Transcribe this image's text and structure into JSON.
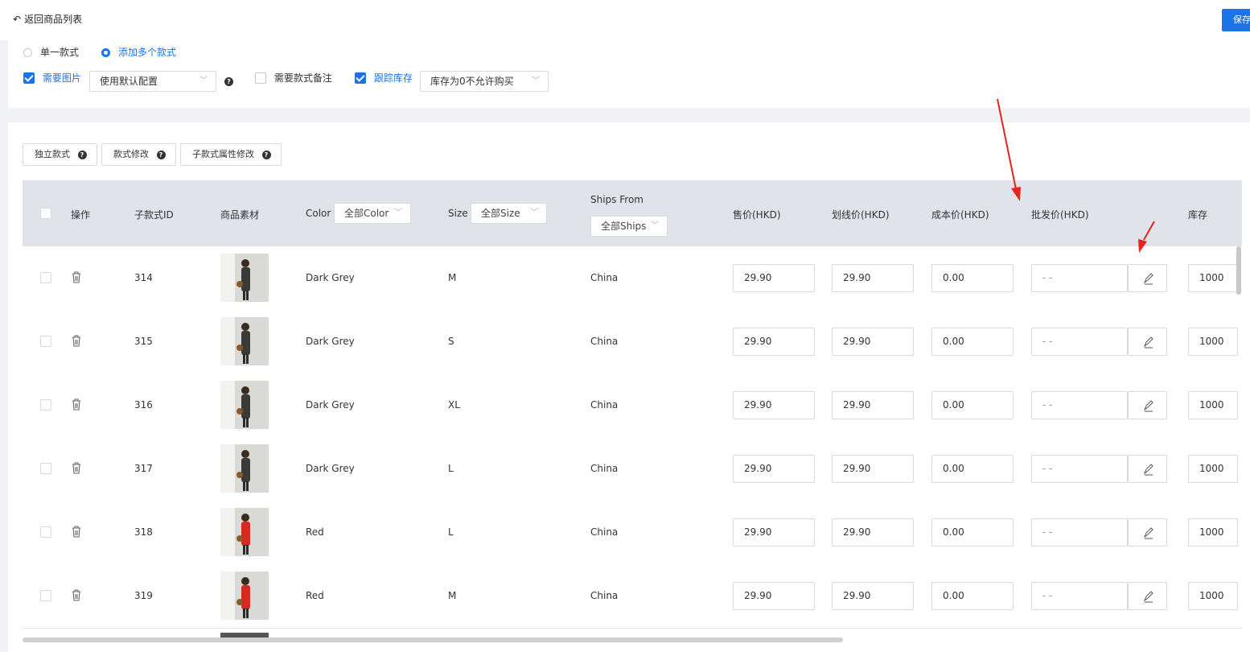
{
  "header": {
    "back_label": "返回商品列表",
    "save_label": "保存"
  },
  "variant_mode": {
    "single_label": "单一款式",
    "multi_label": "添加多个款式",
    "selected": "multi"
  },
  "options": {
    "need_image_label": "需要图片",
    "need_image_checked": true,
    "image_config_value": "使用默认配置",
    "need_remark_label": "需要款式备注",
    "need_remark_checked": false,
    "track_stock_label": "跟踪库存",
    "track_stock_checked": true,
    "stock_policy_value": "库存为0不允许购买"
  },
  "toolbar": {
    "independent_label": "独立款式",
    "variant_edit_label": "款式修改",
    "sub_attr_edit_label": "子款式属性修改"
  },
  "table": {
    "headers": {
      "action": "操作",
      "sub_id": "子款式ID",
      "material": "商品素材",
      "color": "Color",
      "color_filter": "全部Color",
      "size": "Size",
      "size_filter": "全部Size",
      "ships_from": "Ships From",
      "ships_filter": "全部Ships",
      "sale_price": "售价(HKD)",
      "strike_price": "划线价(HKD)",
      "cost_price": "成本价(HKD)",
      "wholesale_price": "批发价(HKD)",
      "stock": "库存"
    },
    "rows": [
      {
        "id": "314",
        "color": "Dark Grey",
        "size": "M",
        "ships_from": "China",
        "sale": "29.90",
        "strike": "29.90",
        "cost": "0.00",
        "wholesale": "- -",
        "stock": "1000",
        "swatch": "#3a3a3a"
      },
      {
        "id": "315",
        "color": "Dark Grey",
        "size": "S",
        "ships_from": "China",
        "sale": "29.90",
        "strike": "29.90",
        "cost": "0.00",
        "wholesale": "- -",
        "stock": "1000",
        "swatch": "#3a3a3a"
      },
      {
        "id": "316",
        "color": "Dark Grey",
        "size": "XL",
        "ships_from": "China",
        "sale": "29.90",
        "strike": "29.90",
        "cost": "0.00",
        "wholesale": "- -",
        "stock": "1000",
        "swatch": "#3a3a3a"
      },
      {
        "id": "317",
        "color": "Dark Grey",
        "size": "L",
        "ships_from": "China",
        "sale": "29.90",
        "strike": "29.90",
        "cost": "0.00",
        "wholesale": "- -",
        "stock": "1000",
        "swatch": "#3a3a3a"
      },
      {
        "id": "318",
        "color": "Red",
        "size": "L",
        "ships_from": "China",
        "sale": "29.90",
        "strike": "29.90",
        "cost": "0.00",
        "wholesale": "- -",
        "stock": "1000",
        "swatch": "#d42a1f"
      },
      {
        "id": "319",
        "color": "Red",
        "size": "M",
        "ships_from": "China",
        "sale": "29.90",
        "strike": "29.90",
        "cost": "0.00",
        "wholesale": "- -",
        "stock": "1000",
        "swatch": "#d42a1f"
      }
    ]
  },
  "colors": {
    "accent": "#1a73e8",
    "annotation_arrow": "#e8231a",
    "header_bg": "#e0e3ea"
  }
}
